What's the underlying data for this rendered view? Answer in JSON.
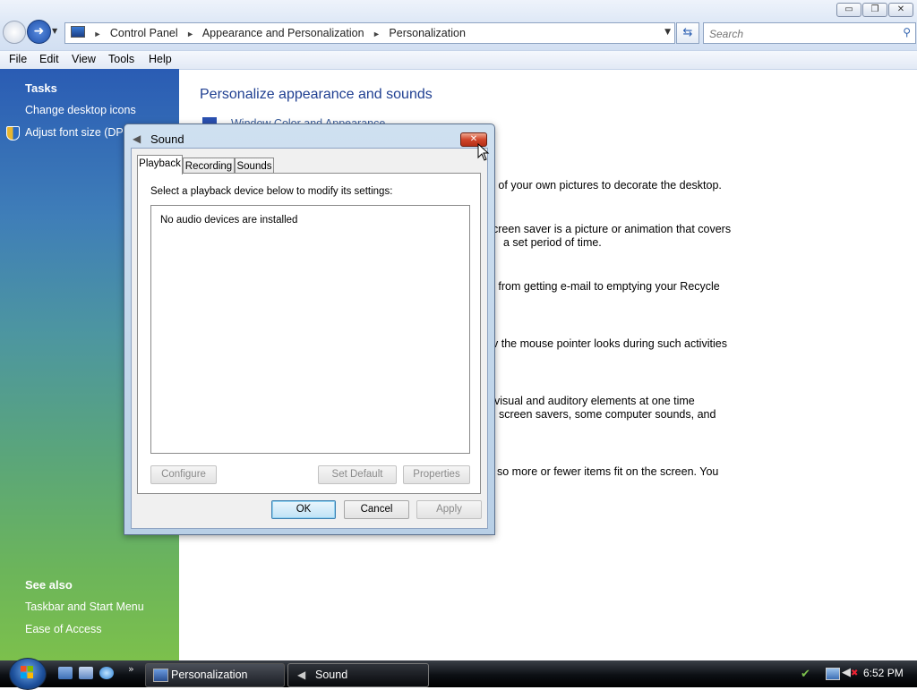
{
  "window": {
    "caption_minimize": "▭",
    "caption_maximize": "❐",
    "caption_close": "✕"
  },
  "address": {
    "crumbs": [
      "Control Panel",
      "Appearance and Personalization",
      "Personalization"
    ]
  },
  "search": {
    "placeholder": "Search"
  },
  "menubar": [
    "File",
    "Edit",
    "View",
    "Tools",
    "Help"
  ],
  "left_pane": {
    "tasks_title": "Tasks",
    "tasks": [
      "Change desktop icons",
      "Adjust font size (DPI)"
    ],
    "see_also_title": "See also",
    "see_also": [
      "Taskbar and Start Menu",
      "Ease of Access"
    ]
  },
  "main": {
    "heading": "Personalize appearance and sounds",
    "partial_link": "Window Color and Appearance",
    "desc_lines": [
      "e of your own pictures to decorate the desktop.",
      "creen saver is a picture or animation that covers",
      "a set period of time.",
      "g from getting e-mail to emptying your Recycle",
      "v the mouse pointer looks during such activities",
      "visual and auditory elements at one time",
      ", screen savers, some computer sounds, and",
      "so more or fewer items fit on the screen. You"
    ]
  },
  "dialog": {
    "title": "Sound",
    "tabs": [
      "Playback",
      "Recording",
      "Sounds"
    ],
    "active_tab": "Playback",
    "instruction": "Select a playback device below to modify its settings:",
    "device_list_message": "No audio devices are installed",
    "buttons": {
      "configure": "Configure",
      "set_default": "Set Default",
      "properties": "Properties",
      "ok": "OK",
      "cancel": "Cancel",
      "apply": "Apply"
    }
  },
  "taskbar": {
    "windows": [
      "Personalization",
      "Sound"
    ],
    "overflow": "»",
    "clock": "6:52 PM"
  }
}
